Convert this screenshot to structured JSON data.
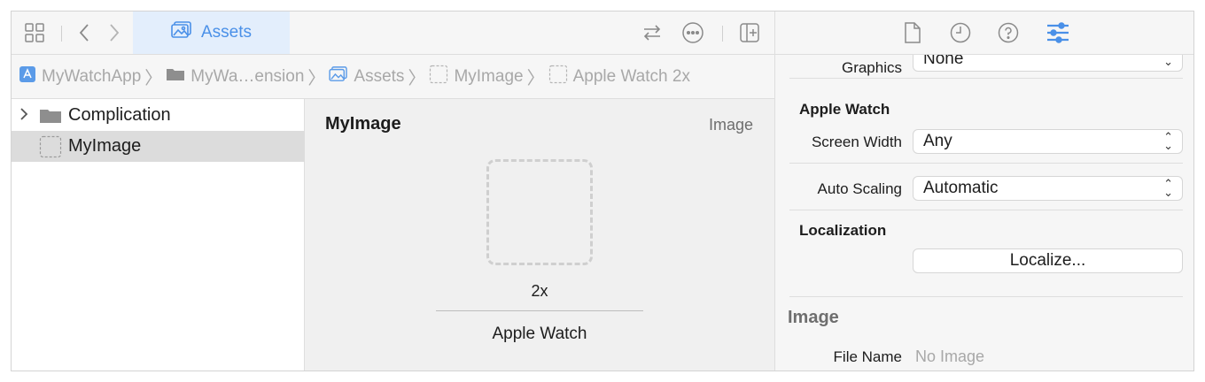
{
  "toolbar": {
    "active_tab_label": "Assets"
  },
  "jumpbar": {
    "crumbs": [
      "MyWatchApp",
      "MyWa…ension",
      "Assets",
      "MyImage",
      "Apple Watch 2x"
    ]
  },
  "outline": {
    "items": [
      {
        "label": "Complication",
        "kind": "folder",
        "expandable": true
      },
      {
        "label": "MyImage",
        "kind": "image-set",
        "selected": true
      }
    ]
  },
  "canvas": {
    "title": "MyImage",
    "type_label": "Image",
    "slot_scale": "2x",
    "slot_device": "Apple Watch"
  },
  "inspector": {
    "graphics_label": "Graphics",
    "graphics_value": "None",
    "section_apple_watch": "Apple Watch",
    "screen_width_label": "Screen Width",
    "screen_width_value": "Any",
    "auto_scaling_label": "Auto Scaling",
    "auto_scaling_value": "Automatic",
    "section_localization": "Localization",
    "localize_button": "Localize...",
    "section_image": "Image",
    "file_name_label": "File Name",
    "file_name_value": "No Image"
  },
  "colors": {
    "accent": "#4a90e8",
    "selection": "#dcdcdc",
    "canvas_bg": "#f0f0f0"
  }
}
